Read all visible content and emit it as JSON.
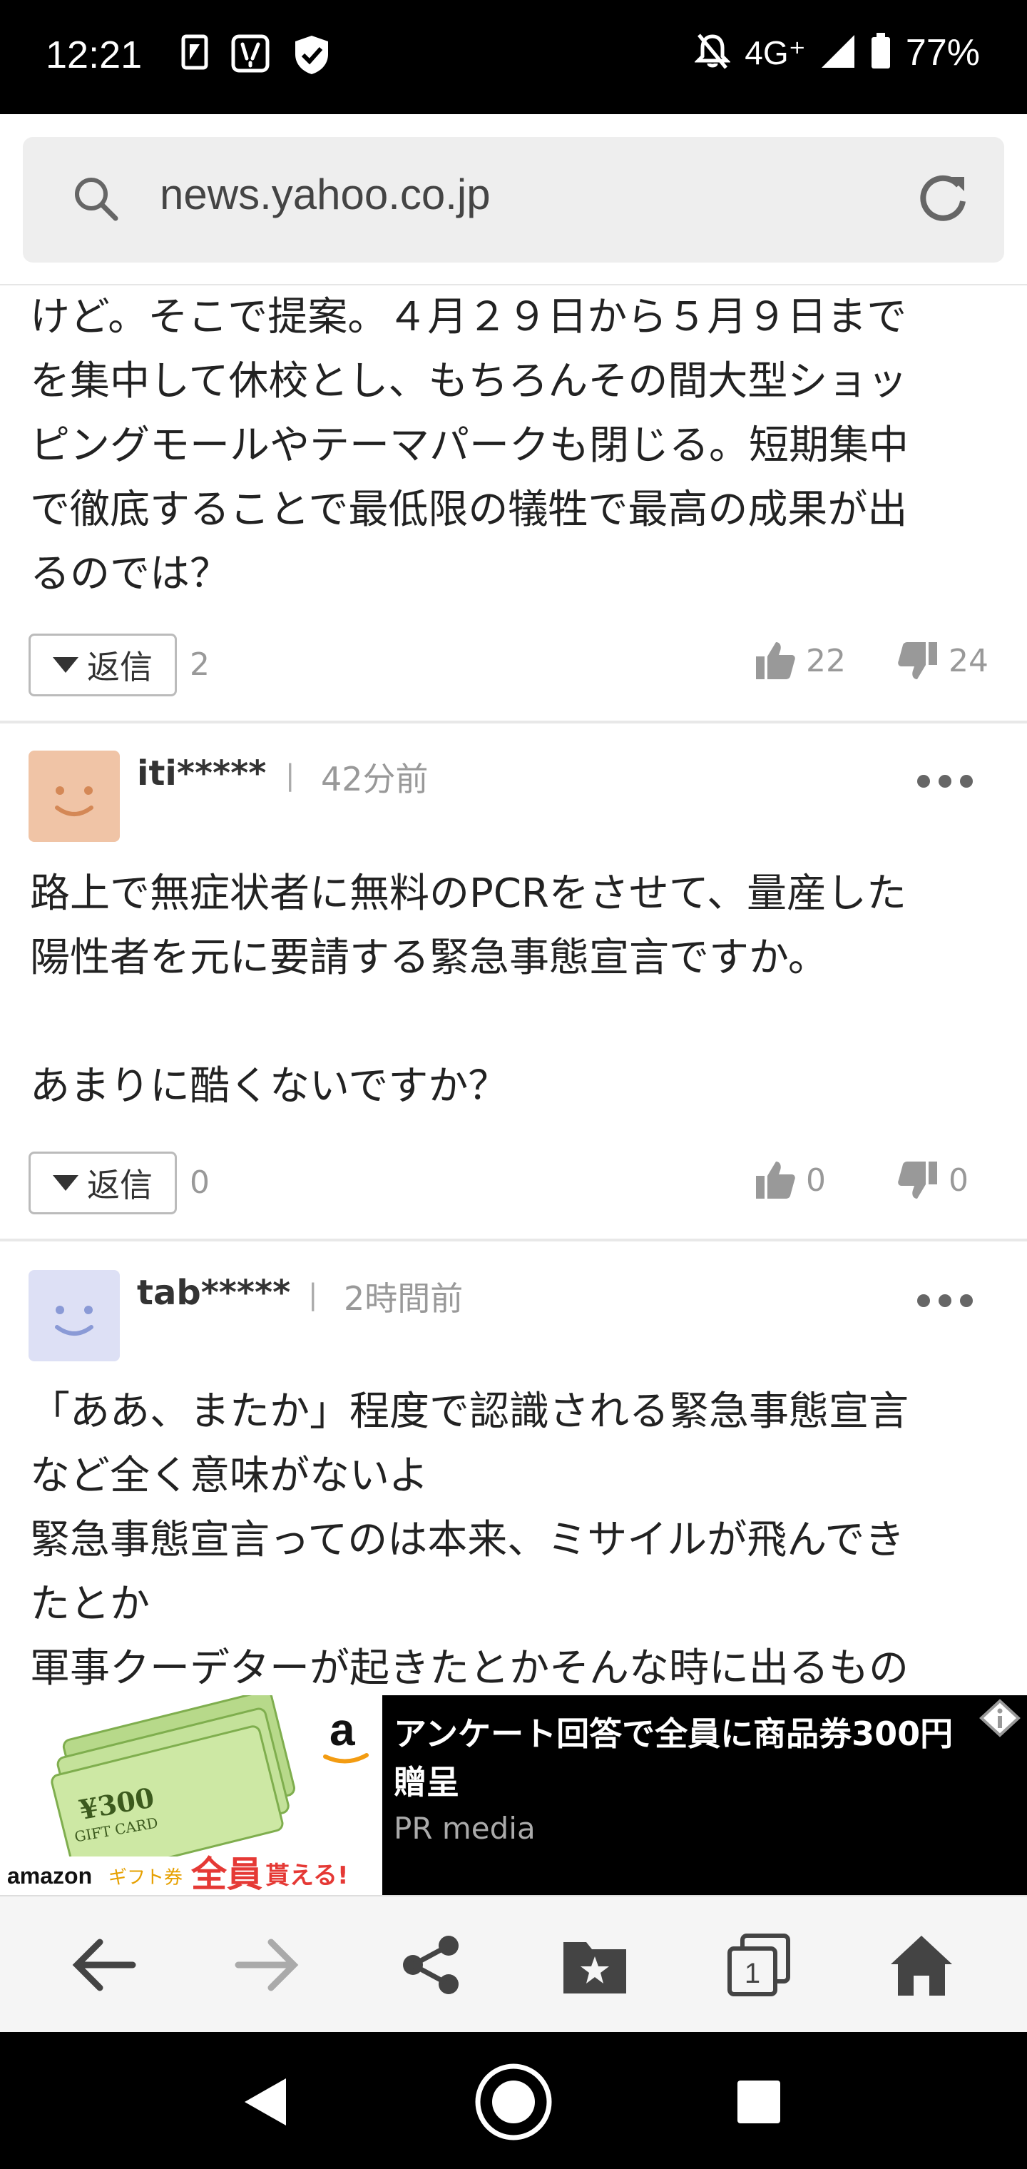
{
  "status_bar": {
    "time": "12:21",
    "network": "4G⁺",
    "battery": "77%"
  },
  "address_bar": {
    "url": "news.yahoo.co.jp"
  },
  "comments": [
    {
      "text_lines": [
        "けど。そこで提案。４月２９日から５月９日まで",
        "を集中して休校とし、もちろんその間大型ショッ",
        "ピングモールやテーマパークも閉じる。短期集中",
        "で徹底することで最低限の犠牲で最高の成果が出",
        "るのでは？"
      ],
      "reply_label": "返信",
      "reply_count": "2",
      "likes": "22",
      "dislikes": "24"
    },
    {
      "username": "iti*****",
      "separator": "|",
      "time_ago": "42分前",
      "avatar_color": "#f0c4a6",
      "text_lines": [
        "路上で無症状者に無料のPCRをさせて、量産した",
        "陽性者を元に要請する緊急事態宣言ですか。",
        "",
        "あまりに酷くないですか？"
      ],
      "reply_label": "返信",
      "reply_count": "0",
      "likes": "0",
      "dislikes": "0"
    },
    {
      "username": "tab*****",
      "separator": "|",
      "time_ago": "2時間前",
      "avatar_color": "#dde0f5",
      "text_lines": [
        "「ああ、またか」程度で認識される緊急事態宣言",
        "など全く意味がないよ",
        "緊急事態宣言ってのは本来、ミサイルが飛んでき",
        "たとか",
        "軍事クーデターが起きたとかそんな時に出るもの"
      ]
    }
  ],
  "ad": {
    "title": "アンケート回答で全員に商品券300円贈呈",
    "source": "PR media",
    "image_text": {
      "amount": "¥300",
      "card": "GIFT CARD",
      "brand": "amazon",
      "giftcard": "ギフト券",
      "everyone": "全員",
      "receive": "貰える!"
    }
  },
  "bottom_bar": {
    "tab_count": "1"
  }
}
